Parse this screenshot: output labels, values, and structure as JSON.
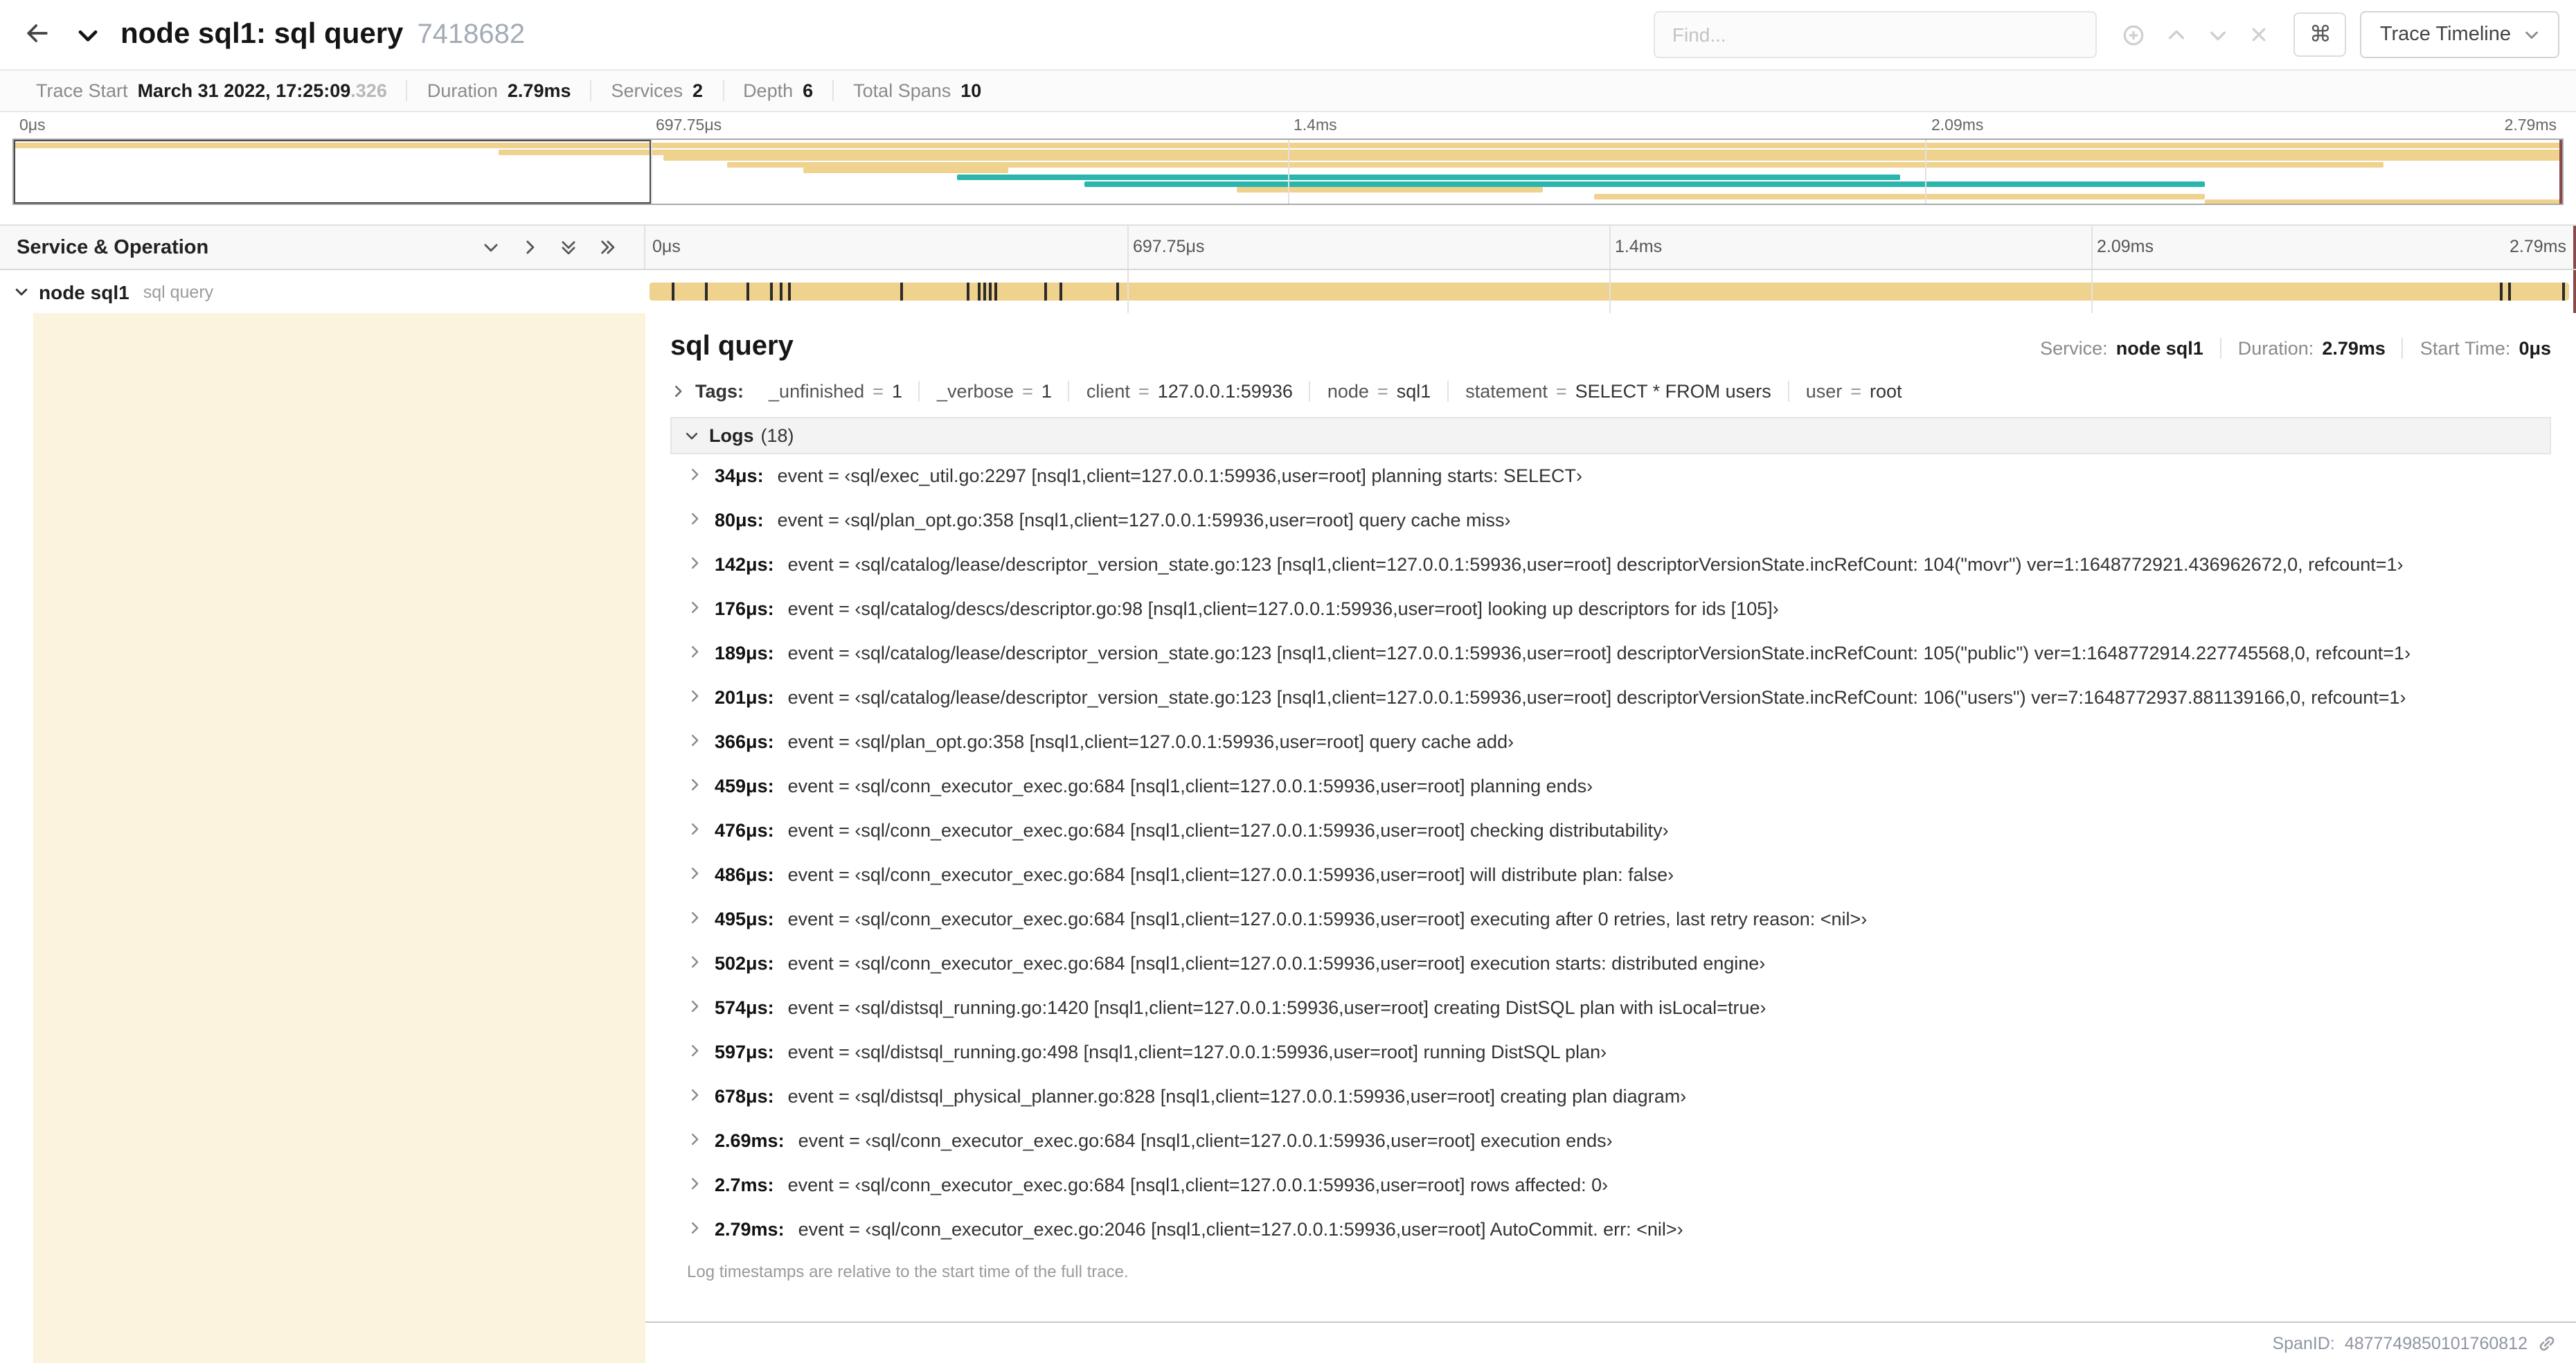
{
  "header": {
    "title": "node sql1: sql query",
    "trace_id": "7418682",
    "find_placeholder": "Find...",
    "command_icon": "⌘",
    "trace_timeline_label": "Trace Timeline"
  },
  "summary": {
    "items": [
      {
        "label": "Trace Start",
        "value": "March 31 2022, 17:25:09",
        "value_dim": ".326"
      },
      {
        "label": "Duration",
        "value": "2.79ms"
      },
      {
        "label": "Services",
        "value": "2"
      },
      {
        "label": "Depth",
        "value": "6"
      },
      {
        "label": "Total Spans",
        "value": "10"
      }
    ]
  },
  "colors": {
    "span_tan": "#efd28e",
    "span_teal": "#2cb5ac",
    "selected_row_bg": "#fbf3de",
    "scrubber_red": "#8b4a4a"
  },
  "minimap": {
    "ticks": [
      "0μs",
      "697.75μs",
      "1.4ms",
      "2.09ms",
      "2.79ms"
    ],
    "tick_positions_pct": [
      0,
      25,
      50,
      75,
      100
    ],
    "selection": {
      "start_pct": 0,
      "width_pct": 25
    },
    "spans": [
      {
        "start": 0,
        "width": 100,
        "color": "span_tan"
      },
      {
        "start": 19,
        "width": 81,
        "color": "span_tan"
      },
      {
        "start": 25.5,
        "width": 74.5,
        "color": "span_tan"
      },
      {
        "start": 28,
        "width": 65,
        "color": "span_tan"
      },
      {
        "start": 31,
        "width": 8,
        "color": "span_tan"
      },
      {
        "start": 37,
        "width": 37,
        "color": "span_teal"
      },
      {
        "start": 42,
        "width": 44,
        "color": "span_teal"
      },
      {
        "start": 48,
        "width": 12,
        "color": "span_tan"
      },
      {
        "start": 62,
        "width": 24,
        "color": "span_tan"
      },
      {
        "start": 86,
        "width": 14,
        "color": "span_tan"
      }
    ]
  },
  "timeline": {
    "left_header": "Service & Operation",
    "ticks": [
      "0μs",
      "697.75μs",
      "1.4ms",
      "2.09ms",
      "2.79ms"
    ],
    "tick_positions_pct": [
      0,
      25,
      50,
      75,
      100
    ],
    "row": {
      "service": "node sql1",
      "operation": "sql query",
      "bar": {
        "start_pct": 0,
        "width_pct": 100,
        "color": "span_tan"
      },
      "log_ticks_pct": [
        1.2,
        2.9,
        5.1,
        6.3,
        6.8,
        7.2,
        13.1,
        16.5,
        17.1,
        17.4,
        17.7,
        18.0,
        20.6,
        21.4,
        24.3,
        96.4,
        96.8,
        99.6
      ]
    }
  },
  "detail": {
    "title": "sql query",
    "meta": [
      {
        "label": "Service:",
        "value": "node sql1"
      },
      {
        "label": "Duration:",
        "value": "2.79ms"
      },
      {
        "label": "Start Time:",
        "value": "0μs"
      }
    ],
    "tags_label": "Tags:",
    "tag_eq": "=",
    "tags": [
      {
        "key": "_unfinished",
        "value": "1"
      },
      {
        "key": "_verbose",
        "value": "1"
      },
      {
        "key": "client",
        "value": "127.0.0.1:59936"
      },
      {
        "key": "node",
        "value": "sql1"
      },
      {
        "key": "statement",
        "value": "SELECT * FROM users"
      },
      {
        "key": "user",
        "value": "root"
      }
    ],
    "logs_label": "Logs",
    "logs_count_display": "(18)",
    "logs": [
      {
        "time": "34μs:",
        "message": "event = ‹sql/exec_util.go:2297 [nsql1,client=127.0.0.1:59936,user=root] planning starts: SELECT›"
      },
      {
        "time": "80μs:",
        "message": "event = ‹sql/plan_opt.go:358 [nsql1,client=127.0.0.1:59936,user=root] query cache miss›"
      },
      {
        "time": "142μs:",
        "message": "event = ‹sql/catalog/lease/descriptor_version_state.go:123 [nsql1,client=127.0.0.1:59936,user=root] descriptorVersionState.incRefCount: 104(\"movr\") ver=1:1648772921.436962672,0, refcount=1›"
      },
      {
        "time": "176μs:",
        "message": "event = ‹sql/catalog/descs/descriptor.go:98 [nsql1,client=127.0.0.1:59936,user=root] looking up descriptors for ids [105]›"
      },
      {
        "time": "189μs:",
        "message": "event = ‹sql/catalog/lease/descriptor_version_state.go:123 [nsql1,client=127.0.0.1:59936,user=root] descriptorVersionState.incRefCount: 105(\"public\") ver=1:1648772914.227745568,0, refcount=1›"
      },
      {
        "time": "201μs:",
        "message": "event = ‹sql/catalog/lease/descriptor_version_state.go:123 [nsql1,client=127.0.0.1:59936,user=root] descriptorVersionState.incRefCount: 106(\"users\") ver=7:1648772937.881139166,0, refcount=1›"
      },
      {
        "time": "366μs:",
        "message": "event = ‹sql/plan_opt.go:358 [nsql1,client=127.0.0.1:59936,user=root] query cache add›"
      },
      {
        "time": "459μs:",
        "message": "event = ‹sql/conn_executor_exec.go:684 [nsql1,client=127.0.0.1:59936,user=root] planning ends›"
      },
      {
        "time": "476μs:",
        "message": "event = ‹sql/conn_executor_exec.go:684 [nsql1,client=127.0.0.1:59936,user=root] checking distributability›"
      },
      {
        "time": "486μs:",
        "message": "event = ‹sql/conn_executor_exec.go:684 [nsql1,client=127.0.0.1:59936,user=root] will distribute plan: false›"
      },
      {
        "time": "495μs:",
        "message": "event = ‹sql/conn_executor_exec.go:684 [nsql1,client=127.0.0.1:59936,user=root] executing after 0 retries, last retry reason: <nil>›"
      },
      {
        "time": "502μs:",
        "message": "event = ‹sql/conn_executor_exec.go:684 [nsql1,client=127.0.0.1:59936,user=root] execution starts: distributed engine›"
      },
      {
        "time": "574μs:",
        "message": "event = ‹sql/distsql_running.go:1420 [nsql1,client=127.0.0.1:59936,user=root] creating DistSQL plan with isLocal=true›"
      },
      {
        "time": "597μs:",
        "message": "event = ‹sql/distsql_running.go:498 [nsql1,client=127.0.0.1:59936,user=root] running DistSQL plan›"
      },
      {
        "time": "678μs:",
        "message": "event = ‹sql/distsql_physical_planner.go:828 [nsql1,client=127.0.0.1:59936,user=root] creating plan diagram›"
      },
      {
        "time": "2.69ms:",
        "message": "event = ‹sql/conn_executor_exec.go:684 [nsql1,client=127.0.0.1:59936,user=root] execution ends›"
      },
      {
        "time": "2.7ms:",
        "message": "event = ‹sql/conn_executor_exec.go:684 [nsql1,client=127.0.0.1:59936,user=root] rows affected: 0›"
      },
      {
        "time": "2.79ms:",
        "message": "event = ‹sql/conn_executor_exec.go:2046 [nsql1,client=127.0.0.1:59936,user=root] AutoCommit. err: <nil>›"
      }
    ],
    "logs_footnote": "Log timestamps are relative to the start time of the full trace.",
    "span_id_label": "SpanID:",
    "span_id": "4877749850101760812"
  }
}
